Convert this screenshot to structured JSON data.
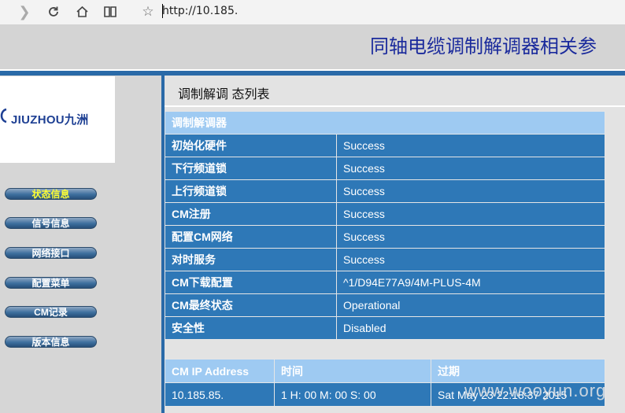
{
  "browser": {
    "url": "http://10.185.",
    "icons": [
      "forward-icon",
      "refresh-icon",
      "home-icon",
      "reader-icon",
      "favorite-icon"
    ]
  },
  "page": {
    "title": "同轴电缆调制解调器相关参",
    "logo_text": "JIUZHOU九洲"
  },
  "nav": {
    "items": [
      {
        "label": "状态信息",
        "active": true
      },
      {
        "label": "信号信息",
        "active": false
      },
      {
        "label": "网络接口",
        "active": false
      },
      {
        "label": "配置菜单",
        "active": false
      },
      {
        "label": "CM记录",
        "active": false
      },
      {
        "label": "版本信息",
        "active": false
      }
    ]
  },
  "main": {
    "heading": "调制解调 态列表",
    "table_header": "调制解调器",
    "rows": [
      {
        "key": "初始化硬件",
        "value": "Success"
      },
      {
        "key": "下行频道锁",
        "value": "Success"
      },
      {
        "key": "上行频道锁",
        "value": "Success"
      },
      {
        "key": "CM注册",
        "value": "Success"
      },
      {
        "key": "配置CM网络",
        "value": "Success"
      },
      {
        "key": "对时服务",
        "value": "Success"
      },
      {
        "key": "CM下载配置",
        "value": "^1/D94E77A9/4M-PLUS-4M"
      },
      {
        "key": "CM最终状态",
        "value": "Operational"
      },
      {
        "key": "安全性",
        "value": "Disabled"
      }
    ],
    "ip_table": {
      "headers": [
        "CM IP Address",
        "时间",
        "过期"
      ],
      "row": [
        "10.185.85.",
        "1 H: 00 M: 00 S: 00",
        "Sat May 23 22:18:37 2015"
      ]
    }
  },
  "watermark": "www.wooyun.org",
  "colors": {
    "title_blue": "#1a2a9c",
    "row_blue": "#2e78b7",
    "header_light_blue": "#9ecaf2",
    "nav_active_text": "#ffff33"
  }
}
